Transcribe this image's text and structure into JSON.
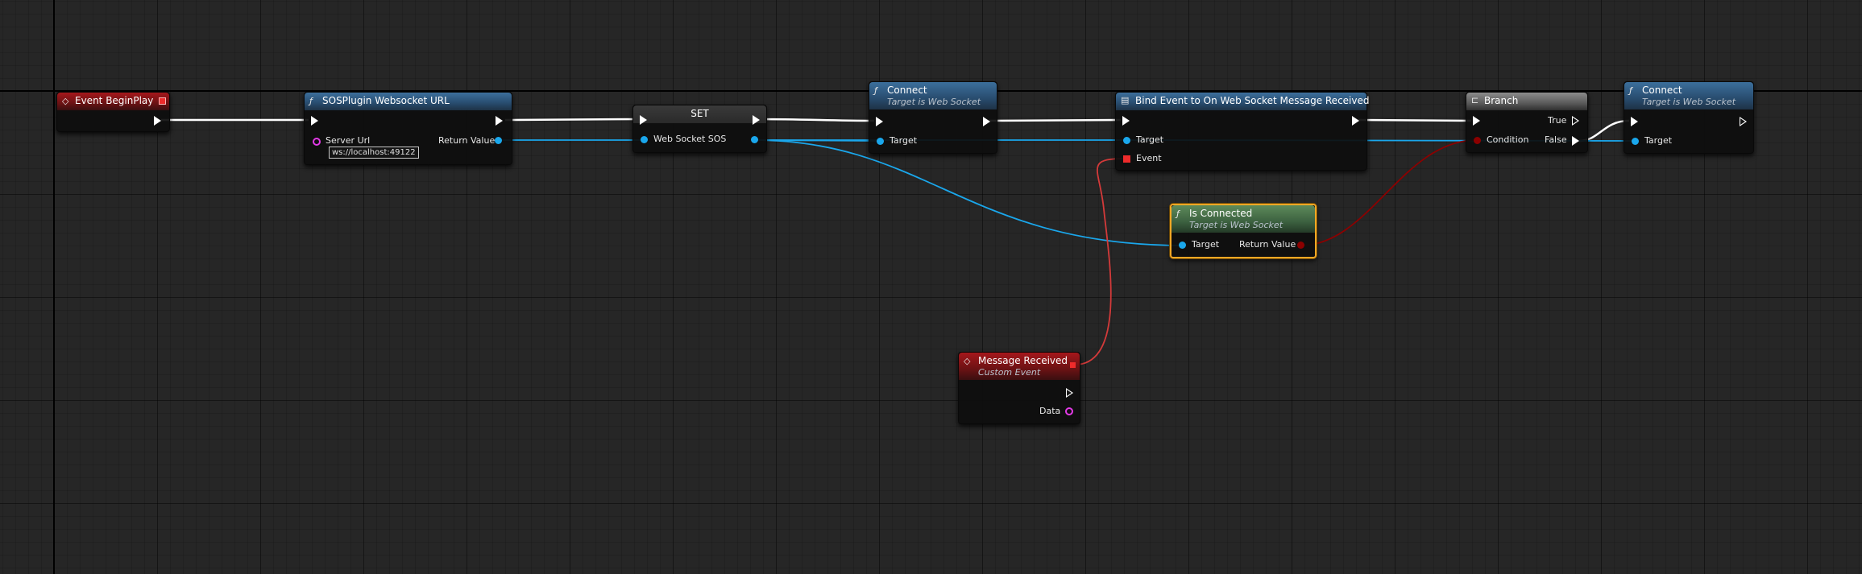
{
  "nodes": {
    "begin_play": {
      "title": "Event BeginPlay"
    },
    "url": {
      "title": "SOSPlugin Websocket URL",
      "server_url_label": "Server Url",
      "server_url_value": "ws://localhost:49122",
      "return_label": "Return Value"
    },
    "set": {
      "title": "SET",
      "var_label": "Web Socket SOS"
    },
    "connect1": {
      "title": "Connect",
      "subtitle": "Target is Web Socket",
      "target_label": "Target"
    },
    "bind": {
      "title": "Bind Event to On Web Socket Message Received",
      "target_label": "Target",
      "event_label": "Event"
    },
    "branch": {
      "title": "Branch",
      "condition_label": "Condition",
      "true_label": "True",
      "false_label": "False"
    },
    "connect2": {
      "title": "Connect",
      "subtitle": "Target is Web Socket",
      "target_label": "Target"
    },
    "is_connected": {
      "title": "Is Connected",
      "subtitle": "Target is Web Socket",
      "target_label": "Target",
      "return_label": "Return Value"
    },
    "message_received": {
      "title": "Message Received",
      "subtitle": "Custom Event",
      "data_label": "Data"
    }
  },
  "colors": {
    "exec_wire": "#ffffff",
    "object_wire": "#1aa7ec",
    "bool_wire": "#8c0000",
    "delegate_wire": "#d43a3a",
    "selection": "#f4a724"
  },
  "icons": {
    "event": "event-diamond-icon",
    "function": "function-f-icon",
    "branch": "branch-icon",
    "bind": "bind-event-icon"
  }
}
